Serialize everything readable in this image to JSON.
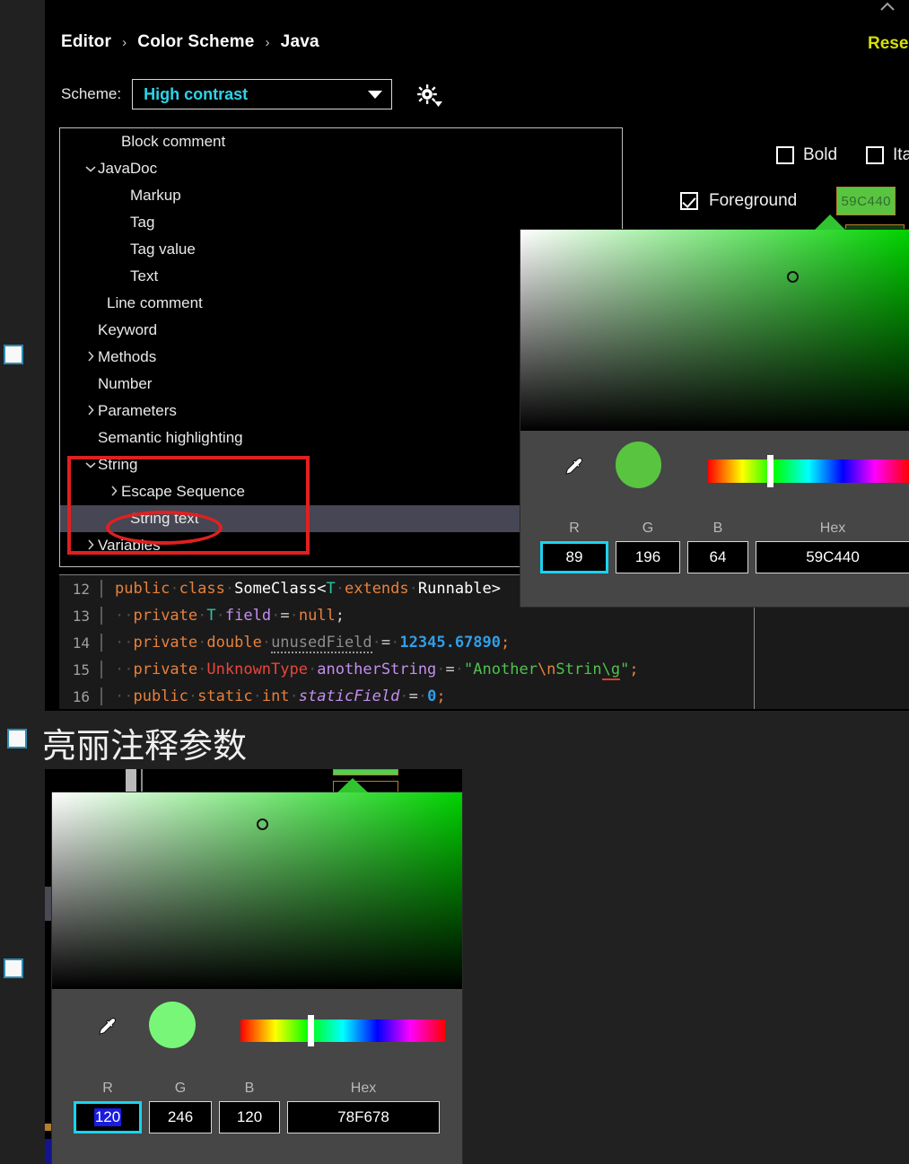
{
  "window": {
    "background": "#212121",
    "panel_background": "#000000"
  },
  "header": {
    "breadcrumb": [
      "Editor",
      "Color Scheme",
      "Java"
    ],
    "separator": "›",
    "reset_label": "Rese",
    "reset_color": "#d6e000",
    "scroll_chevron_icon": "chevron-up-icon"
  },
  "scheme": {
    "label": "Scheme:",
    "value": "High contrast",
    "value_color": "#2fd2e8",
    "caret_icon": "chevron-down-icon",
    "gear_icon": "gear-icon"
  },
  "tree": {
    "items": [
      {
        "label": "Block comment",
        "indent": 2,
        "arrow": "",
        "selected": false
      },
      {
        "label": "JavaDoc",
        "indent": 1,
        "arrow": "v",
        "selected": false
      },
      {
        "label": "Markup",
        "indent": 3,
        "arrow": "",
        "selected": false
      },
      {
        "label": "Tag",
        "indent": 3,
        "arrow": "",
        "selected": false
      },
      {
        "label": "Tag value",
        "indent": 3,
        "arrow": "",
        "selected": false
      },
      {
        "label": "Text",
        "indent": 3,
        "arrow": "",
        "selected": false
      },
      {
        "label": "Line comment",
        "indent": 2,
        "arrow": "",
        "selected": false
      },
      {
        "label": "Keyword",
        "indent": 1,
        "arrow": "",
        "selected": false
      },
      {
        "label": "Methods",
        "indent": 1,
        "arrow": ">",
        "selected": false
      },
      {
        "label": "Number",
        "indent": 1,
        "arrow": "",
        "selected": false
      },
      {
        "label": "Parameters",
        "indent": 1,
        "arrow": ">",
        "selected": false
      },
      {
        "label": "Semantic highlighting",
        "indent": 1,
        "arrow": "",
        "selected": false
      },
      {
        "label": "String",
        "indent": 1,
        "arrow": "v",
        "selected": false
      },
      {
        "label": "Escape Sequence",
        "indent": 2,
        "arrow": ">",
        "selected": false
      },
      {
        "label": "String text",
        "indent": 3,
        "arrow": "",
        "selected": true
      },
      {
        "label": "Variables",
        "indent": 1,
        "arrow": ">",
        "selected": false
      }
    ],
    "selected_row_color": "#464654"
  },
  "attributes": {
    "bold": {
      "label": "Bold",
      "checked": false
    },
    "italic": {
      "label": "Italic",
      "checked": false
    },
    "foreground": {
      "label": "Foreground",
      "checked": true,
      "swatch_value": "59C440"
    }
  },
  "code_preview": {
    "lines": [
      {
        "num": "12"
      },
      {
        "num": "13"
      },
      {
        "num": "14"
      },
      {
        "num": "15"
      },
      {
        "num": "16"
      }
    ],
    "line12": {
      "kw_public": "public",
      "kw_class": "class",
      "name": "SomeClass",
      "lt": "<",
      "generic": "T",
      "kw_extends": "extends",
      "runnable": "Runnable",
      "gt": ">"
    },
    "line13": {
      "kw_private": "private",
      "type": "T",
      "field": "field",
      "eq": "=",
      "kw_null": "null",
      "semi": ";"
    },
    "line14": {
      "kw_private": "private",
      "kw_double": "double",
      "field": "unusedField",
      "eq": "=",
      "number": "12345.67890",
      "semi": ";"
    },
    "line15": {
      "kw_private": "private",
      "type": "UnknownType",
      "field": "anotherString",
      "eq": "=",
      "str_open": "\"Another",
      "esc1": "\\n",
      "str_mid": "Strin",
      "esc2": "\\g",
      "str_close": "\"",
      "semi": ";"
    },
    "line16": {
      "kw_public": "public",
      "kw_static": "static",
      "kw_int": "int",
      "field": "staticField",
      "eq": "=",
      "number": "0",
      "semi": ";"
    }
  },
  "picker_top": {
    "hex_label": "Hex",
    "r_label": "R",
    "g_label": "G",
    "b_label": "B",
    "r_value": "89",
    "g_value": "196",
    "b_value": "64",
    "hex_value": "59C440",
    "focused_field": "R",
    "preview_color": "#59c440",
    "eyedropper_icon": "eyedropper-icon",
    "hue_position_pct": 30
  },
  "picker_bottom": {
    "hex_label": "Hex",
    "r_label": "R",
    "g_label": "G",
    "b_label": "B",
    "r_value": "120",
    "g_value": "246",
    "b_value": "120",
    "hex_value": "78F678",
    "focused_field": "R",
    "r_value_selected": true,
    "preview_color": "#78f678",
    "eyedropper_icon": "eyedropper-icon",
    "hue_position_pct": 33
  },
  "annotations": {
    "chinese_note": "亮丽注释参数",
    "red_color": "#e02020"
  }
}
